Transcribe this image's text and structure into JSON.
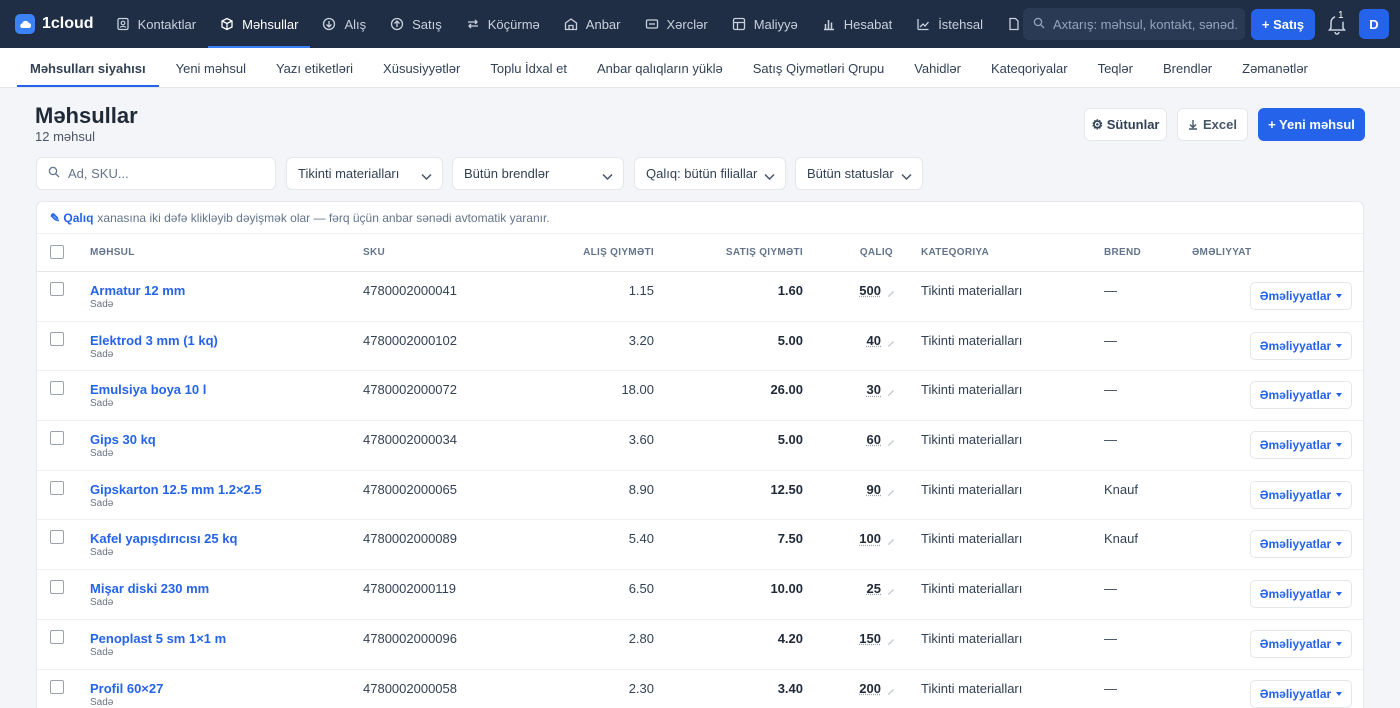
{
  "topnav": {
    "logo": "1cloud",
    "items": [
      {
        "label": "Kontaktlar",
        "icon": "contacts-icon"
      },
      {
        "label": "Məhsullar",
        "icon": "box-icon"
      },
      {
        "label": "Alış",
        "icon": "purchase-icon"
      },
      {
        "label": "Satış",
        "icon": "sale-icon"
      },
      {
        "label": "Köçürmə",
        "icon": "transfer-icon"
      },
      {
        "label": "Anbar",
        "icon": "warehouse-icon"
      },
      {
        "label": "Xərclər",
        "icon": "expense-icon"
      },
      {
        "label": "Maliyyə",
        "icon": "finance-icon"
      },
      {
        "label": "Hesabat",
        "icon": "report-icon"
      },
      {
        "label": "İstehsal",
        "icon": "production-icon"
      }
    ],
    "search_placeholder": "Axtarış: məhsul, kontakt, sənəd...",
    "sale_button": "+ Satış",
    "notification_count": "1",
    "avatar": "D"
  },
  "subnav": {
    "items": [
      "Məhsulları siyahısı",
      "Yeni məhsul",
      "Yazı etiketləri",
      "Xüsusiyyətlər",
      "Toplu İdxal et",
      "Anbar qalıqların yüklə",
      "Satış Qiymətləri Qrupu",
      "Vahidlər",
      "Kateqoriyalar",
      "Teqlər",
      "Brendlər",
      "Zəmanətlər"
    ]
  },
  "header": {
    "title": "Məhsullar",
    "subtitle": "12 məhsul",
    "columns_button": "⚙ Sütunlar",
    "excel_button": "Excel",
    "new_button": "+ Yeni məhsul"
  },
  "filters": {
    "search_placeholder": "Ad, SKU...",
    "category": "Tikinti materialları",
    "brand": "Bütün brendlər",
    "stock": "Qalıq: bütün filiallar",
    "status": "Bütün statuslar"
  },
  "table": {
    "hint_bold": "✎ Qalıq",
    "hint_text": "xanasına iki dəfə klikləyib dəyişmək olar — fərq üçün anbar sənədi avtomatik yaranır.",
    "headers": {
      "product": "Məhsul",
      "sku": "SKU",
      "buy": "Alış qiyməti",
      "sell": "Satış qiyməti",
      "stock": "Qalıq",
      "category": "Kateqoriya",
      "brand": "Brend",
      "actions": "Əməliyyat"
    },
    "action_label": "Əməliyyatlar",
    "rows": [
      {
        "name": "Armatur 12 mm",
        "type": "Sadə",
        "sku": "4780002000041",
        "buy": "1.15",
        "sell": "1.60",
        "stock": "500",
        "category": "Tikinti materialları",
        "brand": "—"
      },
      {
        "name": "Elektrod 3 mm (1 kq)",
        "type": "Sadə",
        "sku": "4780002000102",
        "buy": "3.20",
        "sell": "5.00",
        "stock": "40",
        "category": "Tikinti materialları",
        "brand": "—"
      },
      {
        "name": "Emulsiya boya 10 l",
        "type": "Sadə",
        "sku": "4780002000072",
        "buy": "18.00",
        "sell": "26.00",
        "stock": "30",
        "category": "Tikinti materialları",
        "brand": "—"
      },
      {
        "name": "Gips 30 kq",
        "type": "Sadə",
        "sku": "4780002000034",
        "buy": "3.60",
        "sell": "5.00",
        "stock": "60",
        "category": "Tikinti materialları",
        "brand": "—"
      },
      {
        "name": "Gipskarton 12.5 mm 1.2×2.5",
        "type": "Sadə",
        "sku": "4780002000065",
        "buy": "8.90",
        "sell": "12.50",
        "stock": "90",
        "category": "Tikinti materialları",
        "brand": "Knauf"
      },
      {
        "name": "Kafel yapışdırıcısı 25 kq",
        "type": "Sadə",
        "sku": "4780002000089",
        "buy": "5.40",
        "sell": "7.50",
        "stock": "100",
        "category": "Tikinti materialları",
        "brand": "Knauf"
      },
      {
        "name": "Mişar diski 230 mm",
        "type": "Sadə",
        "sku": "4780002000119",
        "buy": "6.50",
        "sell": "10.00",
        "stock": "25",
        "category": "Tikinti materialları",
        "brand": "—"
      },
      {
        "name": "Penoplast 5 sm 1×1 m",
        "type": "Sadə",
        "sku": "4780002000096",
        "buy": "2.80",
        "sell": "4.20",
        "stock": "150",
        "category": "Tikinti materialları",
        "brand": "—"
      },
      {
        "name": "Profil 60×27",
        "type": "Sadə",
        "sku": "4780002000058",
        "buy": "2.30",
        "sell": "3.40",
        "stock": "200",
        "category": "Tikinti materialları",
        "brand": "—"
      }
    ]
  }
}
